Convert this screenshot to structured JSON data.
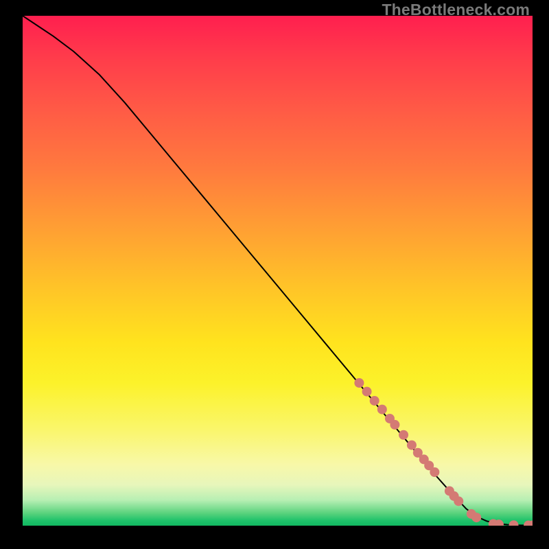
{
  "watermark": "TheBottleneck.com",
  "colors": {
    "frame": "#000000",
    "curve": "#000000",
    "marker": "#d47a74",
    "gradient_top": "#ff1f4f",
    "gradient_bottom": "#12b861"
  },
  "chart_data": {
    "type": "line",
    "title": "",
    "xlabel": "",
    "ylabel": "",
    "xlim": [
      0,
      100
    ],
    "ylim": [
      0,
      100
    ],
    "grid": false,
    "legend": false,
    "series": [
      {
        "name": "bottleneck-curve",
        "x": [
          0,
          3,
          6,
          10,
          15,
          20,
          25,
          30,
          35,
          40,
          45,
          50,
          55,
          60,
          65,
          70,
          75,
          80,
          84,
          87,
          89,
          91,
          93,
          95,
          97,
          99,
          100
        ],
        "y": [
          100,
          98,
          96,
          93,
          88.5,
          83,
          77,
          71,
          65,
          59,
          53,
          47,
          41,
          35,
          29,
          23,
          17,
          11,
          6.5,
          3.3,
          1.8,
          0.9,
          0.4,
          0.2,
          0.1,
          0.06,
          0.06
        ]
      }
    ],
    "markers": [
      {
        "x": 66.0,
        "y": 28.0
      },
      {
        "x": 67.5,
        "y": 26.3
      },
      {
        "x": 69.0,
        "y": 24.5
      },
      {
        "x": 70.5,
        "y": 22.8
      },
      {
        "x": 72.0,
        "y": 21.0
      },
      {
        "x": 73.0,
        "y": 19.8
      },
      {
        "x": 74.7,
        "y": 17.8
      },
      {
        "x": 76.3,
        "y": 15.8
      },
      {
        "x": 77.5,
        "y": 14.3
      },
      {
        "x": 78.7,
        "y": 13.0
      },
      {
        "x": 79.7,
        "y": 11.8
      },
      {
        "x": 80.8,
        "y": 10.5
      },
      {
        "x": 83.7,
        "y": 6.8
      },
      {
        "x": 84.6,
        "y": 5.8
      },
      {
        "x": 85.5,
        "y": 4.8
      },
      {
        "x": 88.0,
        "y": 2.3
      },
      {
        "x": 89.0,
        "y": 1.6
      },
      {
        "x": 92.3,
        "y": 0.35
      },
      {
        "x": 93.4,
        "y": 0.25
      },
      {
        "x": 96.3,
        "y": 0.1
      },
      {
        "x": 99.2,
        "y": 0.06
      },
      {
        "x": 100.0,
        "y": 0.06
      }
    ],
    "marker_radius_px": 7
  }
}
